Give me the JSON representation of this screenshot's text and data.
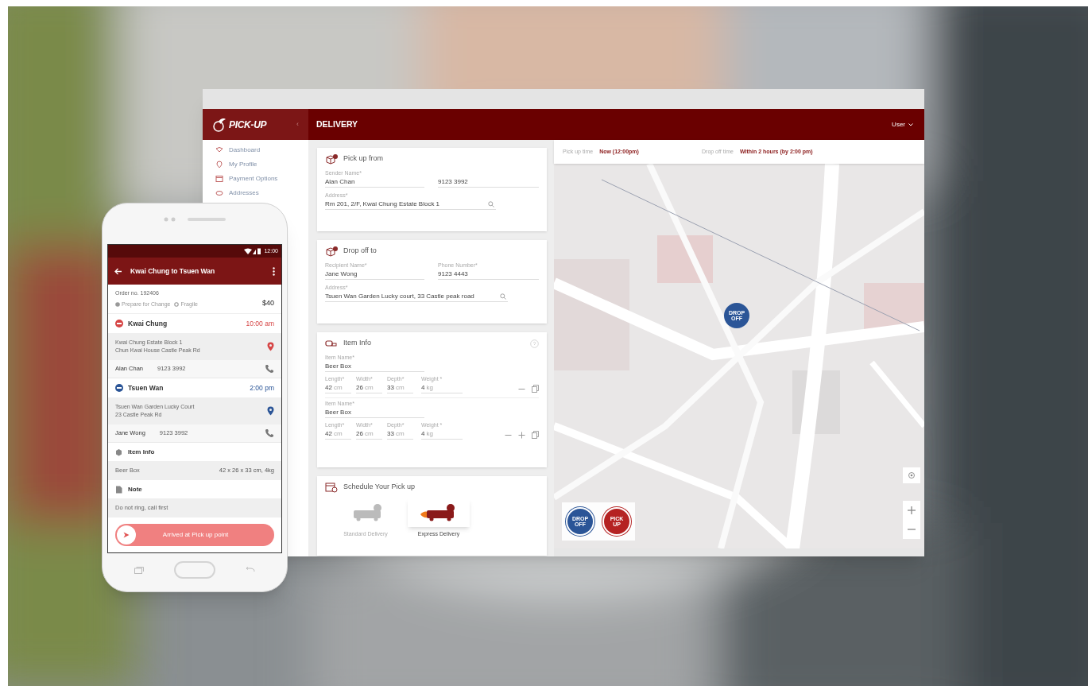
{
  "desktop": {
    "logo": "PICK-UP",
    "collapse": "‹",
    "page_title": "DELIVERY",
    "user_menu": "User",
    "sidebar": [
      {
        "label": "Dashboard",
        "kind": "dashboard"
      },
      {
        "label": "My Profile",
        "kind": "profile"
      },
      {
        "label": "Payment Options",
        "kind": "payment"
      },
      {
        "label": "Addresses",
        "kind": "addresses"
      }
    ],
    "pickup": {
      "title": "Pick up from",
      "name_label": "Sender Name*",
      "name": "Alan Chan",
      "phone": "9123 3992",
      "address_label": "Address*",
      "address": "Rm 201, 2/F, Kwai Chung Estate Block 1"
    },
    "dropoff": {
      "title": "Drop off to",
      "name_label": "Recipient Name*",
      "name": "Jane Wong",
      "phone_label": "Phone Number*",
      "phone": "9123 4443",
      "address_label": "Address*",
      "address": "Tsuen Wan Garden Lucky court, 33 Castle peak road"
    },
    "item_info": {
      "title": "Item Info",
      "items": [
        {
          "name_label": "Item Name*",
          "name": "Beer Box",
          "dims": [
            {
              "label": "Length*",
              "value": "42",
              "unit": "cm"
            },
            {
              "label": "Width*",
              "value": "26",
              "unit": "cm"
            },
            {
              "label": "Depth*",
              "value": "33",
              "unit": "cm"
            },
            {
              "label": "Weight *",
              "value": "4",
              "unit": "kg"
            }
          ],
          "actions": [
            {
              "kind": "remove"
            },
            {
              "kind": "copy"
            }
          ]
        },
        {
          "name_label": "Item Name*",
          "name": "Beer Box",
          "dims": [
            {
              "label": "Length*",
              "value": "42",
              "unit": "cm"
            },
            {
              "label": "Width*",
              "value": "26",
              "unit": "cm"
            },
            {
              "label": "Depth*",
              "value": "33",
              "unit": "cm"
            },
            {
              "label": "Weight *",
              "value": "4",
              "unit": "kg"
            }
          ],
          "actions": [
            {
              "kind": "remove"
            },
            {
              "kind": "add"
            },
            {
              "kind": "copy"
            }
          ]
        }
      ]
    },
    "schedule": {
      "title": "Schedule Your Pick up",
      "options": [
        {
          "label": "Standard Delivery",
          "selected": false
        },
        {
          "label": "Express Delivery",
          "selected": true
        }
      ]
    },
    "times": [
      {
        "label": "Pick up time",
        "value": "Now (12:00pm)"
      },
      {
        "label": "Drop off time",
        "value": "Within 2 hours (by 2:00 pm)"
      }
    ],
    "map": {
      "kind": "picture",
      "marker": "DROP OFF",
      "legend": [
        {
          "label": "DROP OFF",
          "color": "#2b5597"
        },
        {
          "label": "PICK UP",
          "color": "#b52222"
        }
      ]
    }
  },
  "phone": {
    "status_time": "12:00",
    "title": "Kwai Chung to Tsuen Wan",
    "order_no": "Order no. 192406",
    "tags": [
      "Prepare for Change",
      "Fragile"
    ],
    "price": "$40",
    "stops": [
      {
        "name": "Kwai Chung",
        "time": "10:00 am",
        "color": "#d64545",
        "address": [
          "Kwai Chung Estate Block 1",
          "Chun Kwai House Castle Peak Rd"
        ],
        "contact": "Alan Chan",
        "phone": "9123 3992"
      },
      {
        "name": "Tsuen Wan",
        "time": "2:00 pm",
        "color": "#2b5597",
        "address": [
          "Tsuen Wan Garden Lucky Court",
          "23 Castle Peak Rd"
        ],
        "contact": "Jane Wong",
        "phone": "9123 3992"
      }
    ],
    "item_title": "Item Info",
    "item_name": "Beer Box",
    "item_size": "42 x 26 x 33 cm, 4kg",
    "note_title": "Note",
    "note": "Do not ring, call first",
    "button": "Arrived at Pick up point"
  }
}
